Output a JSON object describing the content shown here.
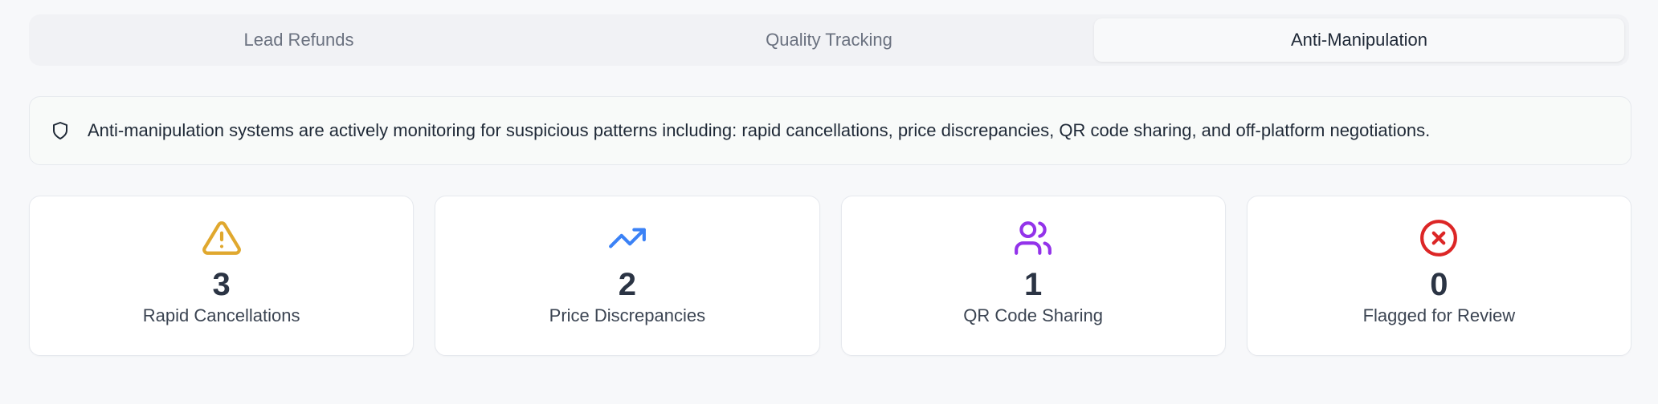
{
  "tabs": [
    {
      "label": "Lead Refunds",
      "active": false
    },
    {
      "label": "Quality Tracking",
      "active": false
    },
    {
      "label": "Anti-Manipulation",
      "active": true
    }
  ],
  "alert": {
    "icon": "shield-icon",
    "text": "Anti-manipulation systems are actively monitoring for suspicious patterns including: rapid cancellations, price discrepancies, QR code sharing, and off-platform negotiations."
  },
  "stats": [
    {
      "value": "3",
      "label": "Rapid Cancellations",
      "icon": "warning-triangle-icon",
      "color": "#e0a82e"
    },
    {
      "value": "2",
      "label": "Price Discrepancies",
      "icon": "trending-up-icon",
      "color": "#3b82f6"
    },
    {
      "value": "1",
      "label": "QR Code Sharing",
      "icon": "users-icon",
      "color": "#9333ea"
    },
    {
      "value": "0",
      "label": "Flagged for Review",
      "icon": "x-circle-icon",
      "color": "#dc2626"
    }
  ]
}
